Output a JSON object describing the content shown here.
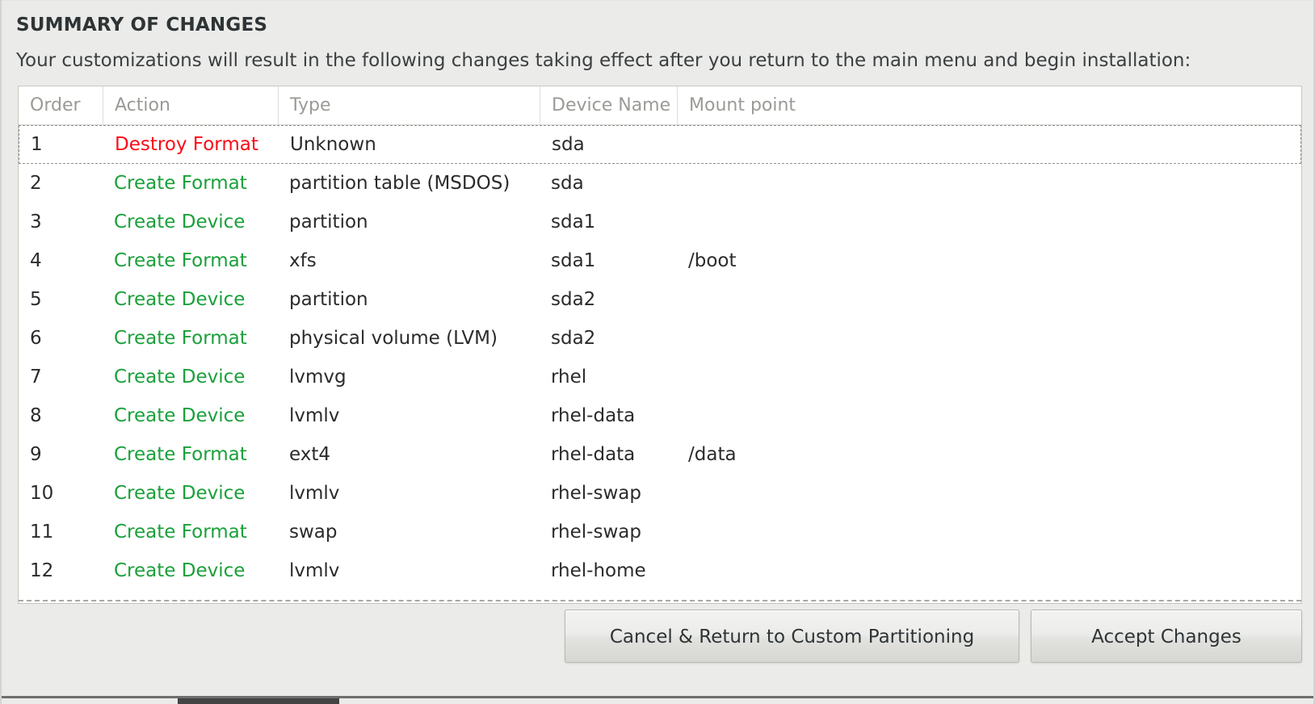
{
  "dialog": {
    "heading": "SUMMARY OF CHANGES",
    "subtitle": "Your customizations will result in the following changes taking effect after you return to the main menu and begin installation:"
  },
  "table": {
    "columns": [
      {
        "key": "order",
        "label": "Order"
      },
      {
        "key": "action",
        "label": "Action"
      },
      {
        "key": "type",
        "label": "Type"
      },
      {
        "key": "device",
        "label": "Device Name"
      },
      {
        "key": "mount",
        "label": "Mount point"
      }
    ],
    "rows": [
      {
        "order": "1",
        "action": "Destroy Format",
        "action_kind": "destroy",
        "type": "Unknown",
        "device": "sda",
        "mount": "",
        "focused": true
      },
      {
        "order": "2",
        "action": "Create Format",
        "action_kind": "create",
        "type": "partition table (MSDOS)",
        "device": "sda",
        "mount": "",
        "focused": false
      },
      {
        "order": "3",
        "action": "Create Device",
        "action_kind": "create",
        "type": "partition",
        "device": "sda1",
        "mount": "",
        "focused": false
      },
      {
        "order": "4",
        "action": "Create Format",
        "action_kind": "create",
        "type": "xfs",
        "device": "sda1",
        "mount": "/boot",
        "focused": false
      },
      {
        "order": "5",
        "action": "Create Device",
        "action_kind": "create",
        "type": "partition",
        "device": "sda2",
        "mount": "",
        "focused": false
      },
      {
        "order": "6",
        "action": "Create Format",
        "action_kind": "create",
        "type": "physical volume (LVM)",
        "device": "sda2",
        "mount": "",
        "focused": false
      },
      {
        "order": "7",
        "action": "Create Device",
        "action_kind": "create",
        "type": "lvmvg",
        "device": "rhel",
        "mount": "",
        "focused": false
      },
      {
        "order": "8",
        "action": "Create Device",
        "action_kind": "create",
        "type": "lvmlv",
        "device": "rhel-data",
        "mount": "",
        "focused": false
      },
      {
        "order": "9",
        "action": "Create Format",
        "action_kind": "create",
        "type": "ext4",
        "device": "rhel-data",
        "mount": "/data",
        "focused": false
      },
      {
        "order": "10",
        "action": "Create Device",
        "action_kind": "create",
        "type": "lvmlv",
        "device": "rhel-swap",
        "mount": "",
        "focused": false
      },
      {
        "order": "11",
        "action": "Create Format",
        "action_kind": "create",
        "type": "swap",
        "device": "rhel-swap",
        "mount": "",
        "focused": false
      },
      {
        "order": "12",
        "action": "Create Device",
        "action_kind": "create",
        "type": "lvmlv",
        "device": "rhel-home",
        "mount": "",
        "focused": false
      }
    ]
  },
  "buttons": {
    "cancel": "Cancel & Return to Custom Partitioning",
    "accept": "Accept Changes"
  },
  "colors": {
    "destroy": "#fb0c17",
    "create": "#1aa03a",
    "header_text": "#9a9a96",
    "body_text": "#2b2b2b",
    "background": "#ebebe9"
  }
}
